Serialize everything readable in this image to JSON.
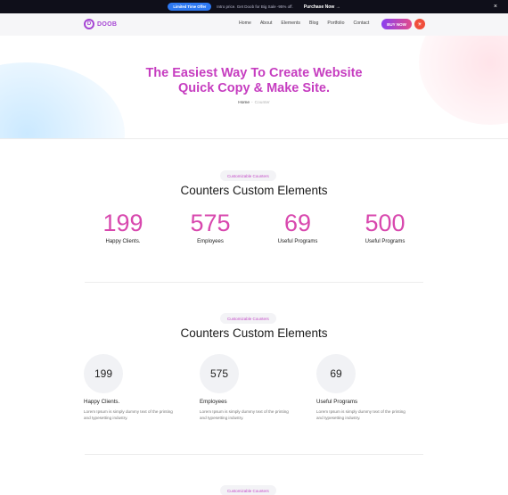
{
  "promo": {
    "badge": "Limited Time Offer",
    "text": "Intro price. Get Doob for Big Sale -95% off.",
    "link": "Purchase Now",
    "arrow": "→",
    "close": "×"
  },
  "header": {
    "logo_mark": "D",
    "logo_text": "DOOB",
    "nav": [
      "Home",
      "About",
      "Elements",
      "Blog",
      "Portfolio",
      "Contact"
    ],
    "buy_label": "BUY NOW",
    "mode_icon": "☀"
  },
  "hero": {
    "title_line1": "The Easiest Way To Create Website",
    "title_line2": "Quick Copy & Make Site.",
    "breadcrumb_home": "Home",
    "breadcrumb_sep": "-",
    "breadcrumb_current": "Counter"
  },
  "section1": {
    "badge": "Customizable Counters",
    "title": "Counters Custom Elements",
    "counters": [
      {
        "value": "199",
        "label": "Happy Clients."
      },
      {
        "value": "575",
        "label": "Employees"
      },
      {
        "value": "69",
        "label": "Useful Programs"
      },
      {
        "value": "500",
        "label": "Useful Programs"
      }
    ]
  },
  "section2": {
    "badge": "Customizable Counters",
    "title": "Counters Custom Elements",
    "cards": [
      {
        "value": "199",
        "title": "Happy Clients.",
        "desc": "Lorem Ipsum is simply dummy text of the printing and typesetting industry."
      },
      {
        "value": "575",
        "title": "Employees",
        "desc": "Lorem Ipsum is simply dummy text of the printing and typesetting industry."
      },
      {
        "value": "69",
        "title": "Useful Programs",
        "desc": "Lorem Ipsum is simply dummy text of the printing and typesetting industry."
      }
    ]
  },
  "section3": {
    "badge": "Customizable Counters"
  },
  "colors": {
    "accent": "#c63dc0",
    "counter_pink": "#d848ae",
    "promo_bg": "#0f0f1a",
    "promo_pill": "#2d78f1",
    "mode_button": "#f04e3b"
  }
}
